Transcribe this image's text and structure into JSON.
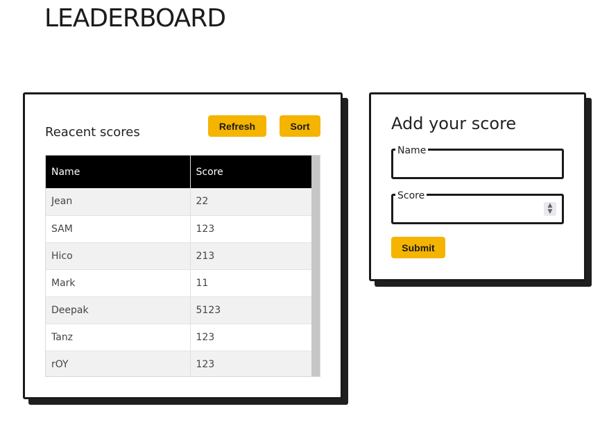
{
  "page": {
    "title": "LEADERBOARD"
  },
  "scores": {
    "title": "Reacent scores",
    "refresh_label": "Refresh",
    "sort_label": "Sort",
    "columns": [
      "Name",
      "Score"
    ],
    "rows": [
      [
        "Jean",
        "22"
      ],
      [
        "SAM",
        "123"
      ],
      [
        "Hico",
        "213"
      ],
      [
        "Mark",
        "11"
      ],
      [
        "Deepak",
        "5123"
      ],
      [
        "Tanz",
        "123"
      ],
      [
        "rOY",
        "123"
      ]
    ]
  },
  "add": {
    "title": "Add your score",
    "name_label": "Name",
    "name_value": "",
    "score_label": "Score",
    "score_value": "",
    "submit_label": "Submit"
  },
  "colors": {
    "accent": "#f5b400",
    "header": "#000000",
    "border": "#1a1a1a"
  },
  "icons": {
    "spinner": "number-spinner-icon"
  }
}
